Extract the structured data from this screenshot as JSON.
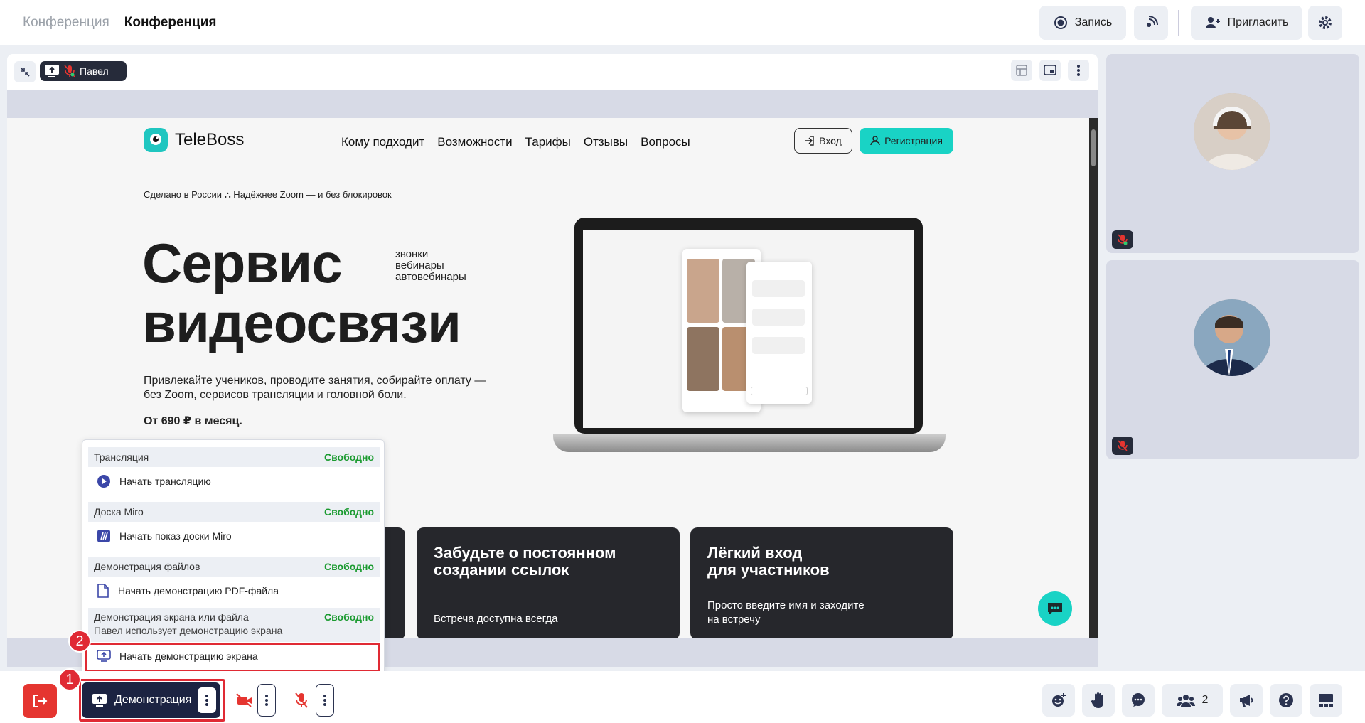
{
  "header": {
    "crumb_parent": "Конференция",
    "crumb_current": "Конференция",
    "record_label": "Запись",
    "invite_label": "Пригласить"
  },
  "share": {
    "presenter": "Павел"
  },
  "site": {
    "logo": "TeleBoss",
    "nav": [
      "Кому подходит",
      "Возможности",
      "Тарифы",
      "Отзывы",
      "Вопросы"
    ],
    "login": "Вход",
    "register": "Регистрация",
    "made": "Сделано в России  ⛬  Надёжнее Zoom — и без блокировок",
    "headline1": "Сервис",
    "headline2": "видеосвязи",
    "tags": [
      "звонки",
      "вебинары",
      "автовебинары"
    ],
    "lead": "Привлекайте учеников, проводите занятия, собирайте оплату — без Zoom, сервисов трансляции и головной боли.",
    "price": "От 690 ₽ в месяц.",
    "cards": [
      {
        "title1": "Забудьте о постоянном",
        "title2": "создании ссылок",
        "sub": "Встреча доступна всегда"
      },
      {
        "title1": "Лёгкий вход",
        "title2": "для участников",
        "sub1": "Просто введите имя и заходите",
        "sub2": "на встречу"
      }
    ]
  },
  "menu": {
    "sections": [
      {
        "title": "Трансляция",
        "status": "Свободно",
        "action": "Начать трансляцию"
      },
      {
        "title": "Доска Miro",
        "status": "Свободно",
        "action": "Начать показ доски Miro"
      },
      {
        "title": "Демонстрация файлов",
        "status": "Свободно",
        "action": "Начать демонстрацию PDF-файла"
      },
      {
        "title": "Демонстрация экрана или файла",
        "status": "Свободно",
        "note": "Павел использует демонстрацию экрана",
        "action": "Начать демонстрацию экрана"
      }
    ]
  },
  "toolbar": {
    "demo_label": "Демонстрация",
    "participants_count": "2"
  },
  "annotations": {
    "step1": "1",
    "step2": "2"
  },
  "colors": {
    "accent": "#19d3c5",
    "danger": "#e53530",
    "navy": "#1c2342",
    "free": "#1a9a2f"
  }
}
